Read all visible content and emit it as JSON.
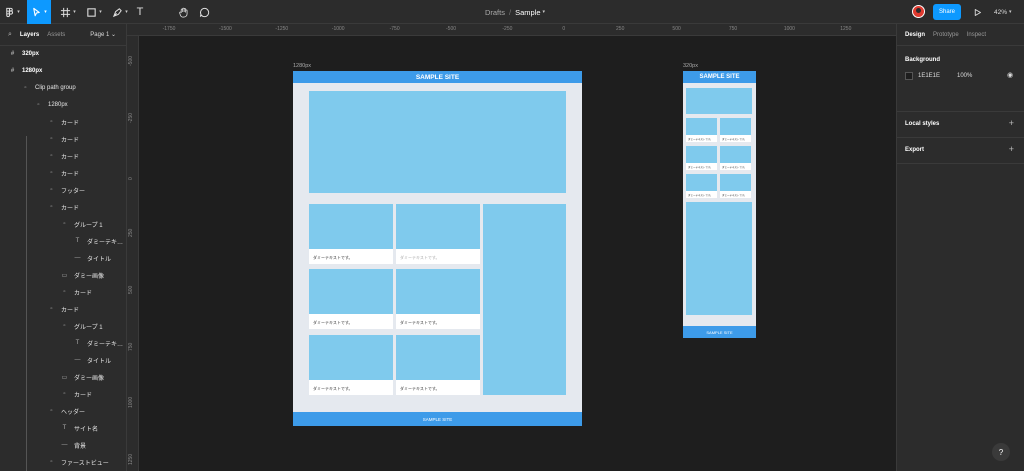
{
  "toolbar": {
    "breadcrumb_drafts": "Drafts",
    "breadcrumb_sep": "/",
    "file_name": "Sample",
    "share_label": "Share",
    "zoom": "42%"
  },
  "left_panel": {
    "tabs": [
      "Layers",
      "Assets"
    ],
    "page": "Page 1",
    "layers": [
      {
        "label": "320px",
        "icon": "frame-icon",
        "glyph": "#",
        "bold": true
      },
      {
        "label": "1280px",
        "icon": "frame-icon",
        "glyph": "#",
        "bold": true
      },
      {
        "label": "Clip path group",
        "icon": "group-icon",
        "glyph": "▫"
      },
      {
        "label": "1280px",
        "icon": "group-icon",
        "glyph": "▫"
      },
      {
        "label": "カード",
        "icon": "group-icon",
        "glyph": "▫"
      },
      {
        "label": "カード",
        "icon": "group-icon",
        "glyph": "▫"
      },
      {
        "label": "カード",
        "icon": "group-icon",
        "glyph": "▫"
      },
      {
        "label": "カード",
        "icon": "group-icon",
        "glyph": "▫"
      },
      {
        "label": "フッター",
        "icon": "group-icon",
        "glyph": "▫"
      },
      {
        "label": "カード",
        "icon": "group-icon",
        "glyph": "▫"
      },
      {
        "label": "グループ 1",
        "icon": "group-icon",
        "glyph": "▫"
      },
      {
        "label": "ダミーテキ…",
        "icon": "text-icon",
        "glyph": "T"
      },
      {
        "label": "タイトル",
        "icon": "line-icon",
        "glyph": "—"
      },
      {
        "label": "ダミー画像",
        "icon": "rectangle-icon",
        "glyph": "▭"
      },
      {
        "label": "カード",
        "icon": "group-icon",
        "glyph": "▫"
      },
      {
        "label": "カード",
        "icon": "group-icon",
        "glyph": "▫"
      },
      {
        "label": "グループ 1",
        "icon": "group-icon",
        "glyph": "▫"
      },
      {
        "label": "ダミーテキ…",
        "icon": "text-icon",
        "glyph": "T"
      },
      {
        "label": "タイトル",
        "icon": "line-icon",
        "glyph": "—"
      },
      {
        "label": "ダミー画像",
        "icon": "rectangle-icon",
        "glyph": "▭"
      },
      {
        "label": "カード",
        "icon": "group-icon",
        "glyph": "▫"
      },
      {
        "label": "ヘッダー",
        "icon": "group-icon",
        "glyph": "▫"
      },
      {
        "label": "サイト名",
        "icon": "text-icon",
        "glyph": "T"
      },
      {
        "label": "背景",
        "icon": "line-icon",
        "glyph": "—"
      },
      {
        "label": "ファーストビュー",
        "icon": "group-icon",
        "glyph": "▫"
      }
    ]
  },
  "rulers": {
    "top": [
      "-1750",
      "-1500",
      "-1250",
      "-1000",
      "-750",
      "-500",
      "-250",
      "0",
      "250",
      "500",
      "750",
      "1000",
      "1250"
    ],
    "left": [
      "-500",
      "-250",
      "0",
      "250",
      "500",
      "750",
      "1000",
      "1250"
    ]
  },
  "canvas": {
    "frame_1280_label": "1280px",
    "frame_320_label": "320px",
    "site_title": "SAMPLE SITE",
    "footer_text": "SAMPLE SITE",
    "card_text": "ダミーテキストです。"
  },
  "right_panel": {
    "tabs": [
      "Design",
      "Prototype",
      "Inspect"
    ],
    "background_title": "Background",
    "background_hex": "1E1E1E",
    "background_opacity": "100%",
    "local_styles": "Local styles",
    "export": "Export"
  },
  "colors": {
    "accent": "#0d99ff",
    "site_blue": "#3d9be9",
    "placeholder_blue": "#7fcaed",
    "canvas_bg": "#1e1e1e"
  }
}
